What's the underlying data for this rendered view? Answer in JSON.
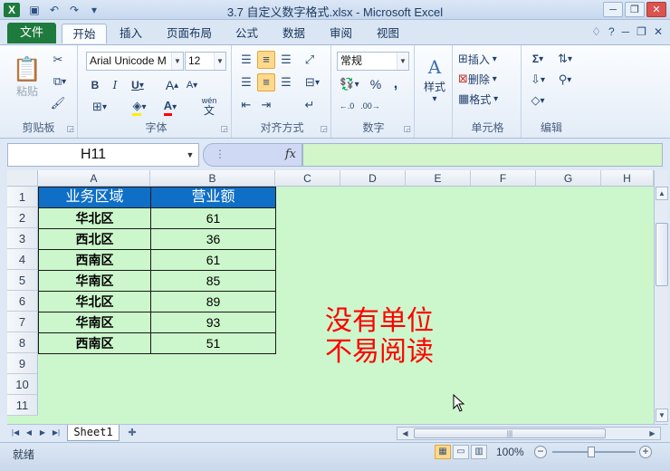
{
  "window": {
    "title": "3.7 自定义数字格式.xlsx  -  Microsoft Excel",
    "app_icon": "X",
    "qat_icons": [
      "save-icon",
      "undo-icon",
      "redo-icon",
      "customize-qat-icon"
    ]
  },
  "ribbon_tabs": [
    "文件",
    "开始",
    "插入",
    "页面布局",
    "公式",
    "数据",
    "审阅",
    "视图"
  ],
  "active_tab": "开始",
  "ribbon": {
    "clipboard": {
      "paste": "粘贴",
      "label": "剪贴板"
    },
    "font": {
      "name": "Arial Unicode M",
      "size": "12",
      "label": "字体",
      "bold": "B",
      "italic": "I",
      "underline": "U",
      "grow": "A",
      "shrink": "A",
      "phonetic": "wén"
    },
    "alignment": {
      "label": "对齐方式"
    },
    "number": {
      "format": "常规",
      "label": "数字",
      "percent": "%",
      "comma": ","
    },
    "styles": {
      "label": "样式"
    },
    "cells": {
      "insert": "插入",
      "delete": "删除",
      "format": "格式",
      "label": "单元格"
    },
    "editing": {
      "label": "编辑",
      "sum": "Σ"
    }
  },
  "formula_bar": {
    "name_box": "H11",
    "fx": "fx",
    "formula": ""
  },
  "columns": [
    "A",
    "B",
    "C",
    "D",
    "E",
    "F",
    "G",
    "H"
  ],
  "rows": [
    "1",
    "2",
    "3",
    "4",
    "5",
    "6",
    "7",
    "8",
    "9",
    "10",
    "11"
  ],
  "table": {
    "headers": [
      "业务区域",
      "营业额"
    ],
    "rows": [
      [
        "华北区",
        "61"
      ],
      [
        "西北区",
        "36"
      ],
      [
        "西南区",
        "61"
      ],
      [
        "华南区",
        "85"
      ],
      [
        "华北区",
        "89"
      ],
      [
        "华南区",
        "93"
      ],
      [
        "西南区",
        "51"
      ]
    ]
  },
  "annotation": {
    "line1": "没有单位",
    "line2": "不易阅读",
    "color": "#ff0000"
  },
  "sheet_tabs": [
    "Sheet1"
  ],
  "status": {
    "ready": "就绪",
    "zoom": "100%"
  },
  "colors": {
    "header_fill": "#0f6fc6",
    "sheet_bg": "#ccf7cc",
    "file_tab": "#1e7a3d"
  }
}
